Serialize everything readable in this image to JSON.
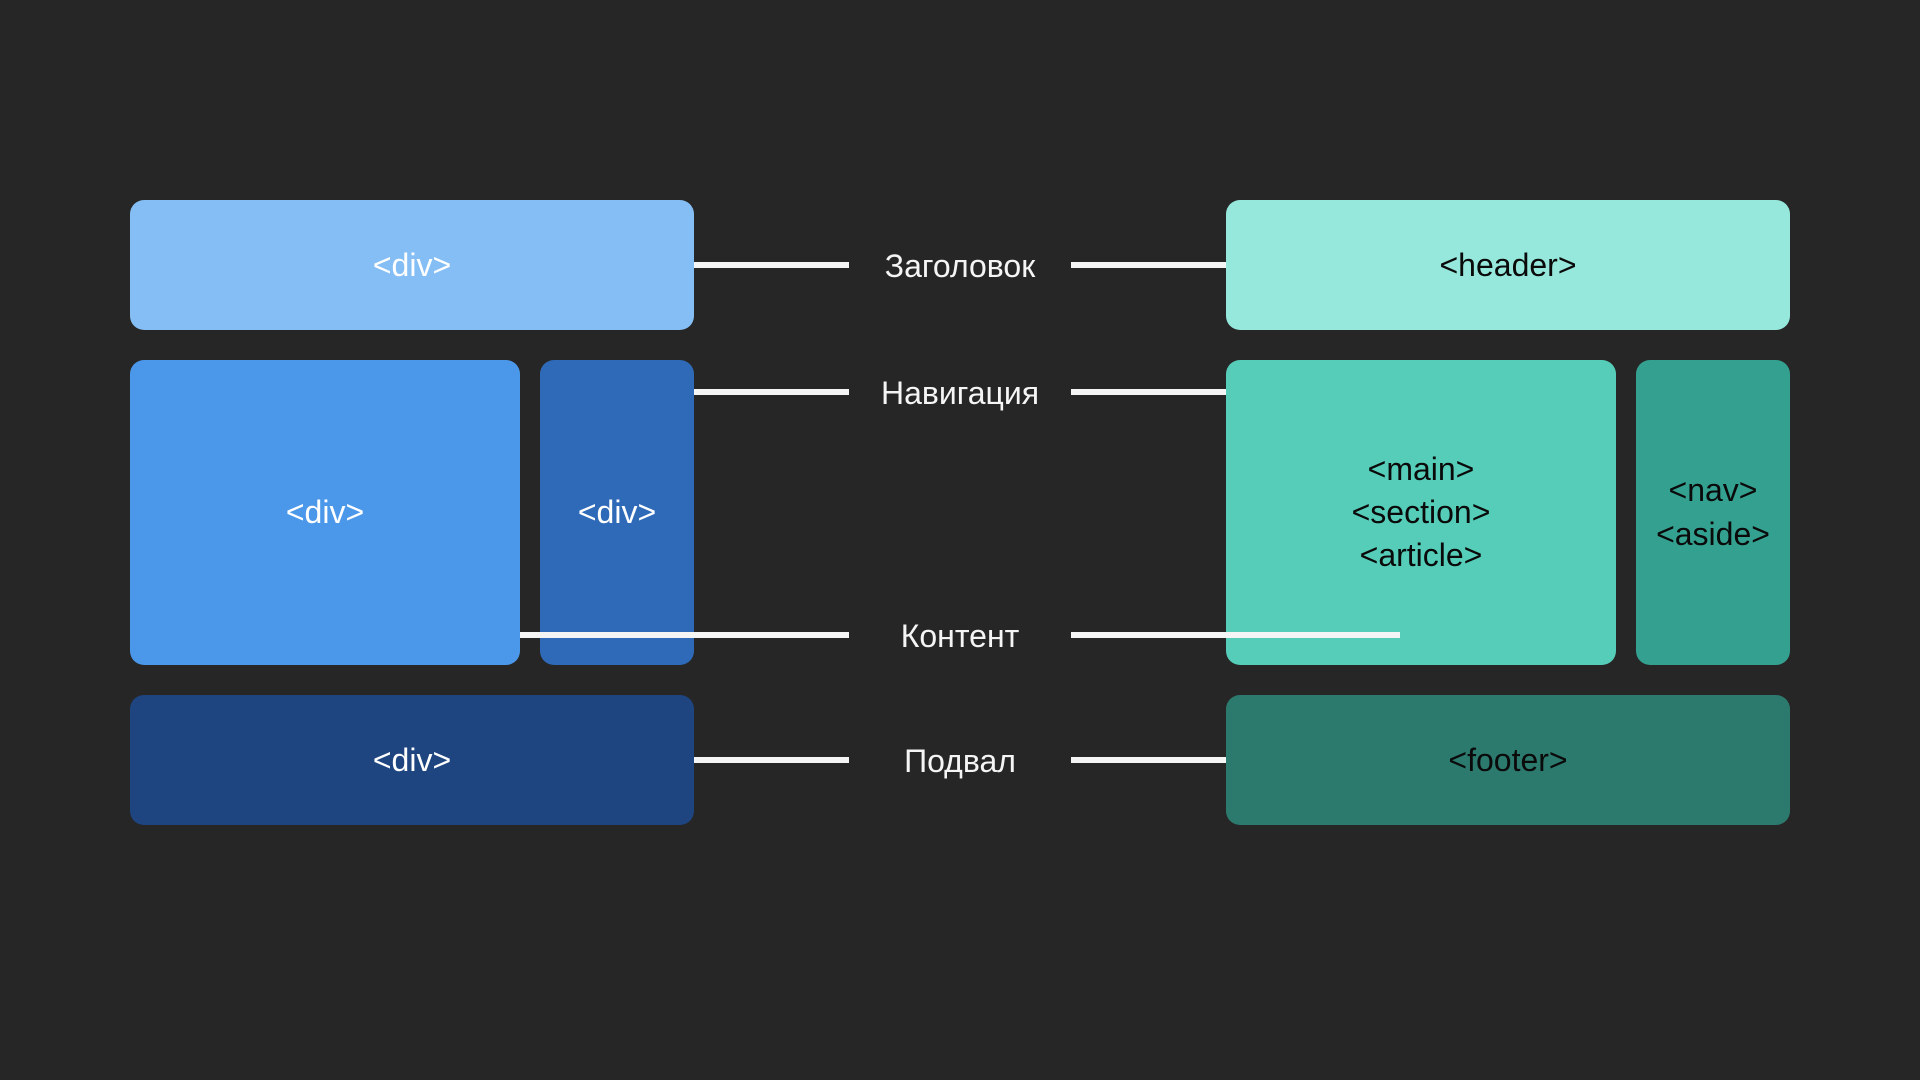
{
  "left": {
    "header": "<div>",
    "content": "<div>",
    "nav": "<div>",
    "footer": "<div>"
  },
  "right": {
    "header": "<header>",
    "content_line1": "<main>",
    "content_line2": "<section>",
    "content_line3": "<article>",
    "nav_line1": "<nav>",
    "nav_line2": "<aside>",
    "footer": "<footer>"
  },
  "labels": {
    "header": "Заголовок",
    "nav": "Навигация",
    "content": "Контент",
    "footer": "Подвал"
  }
}
